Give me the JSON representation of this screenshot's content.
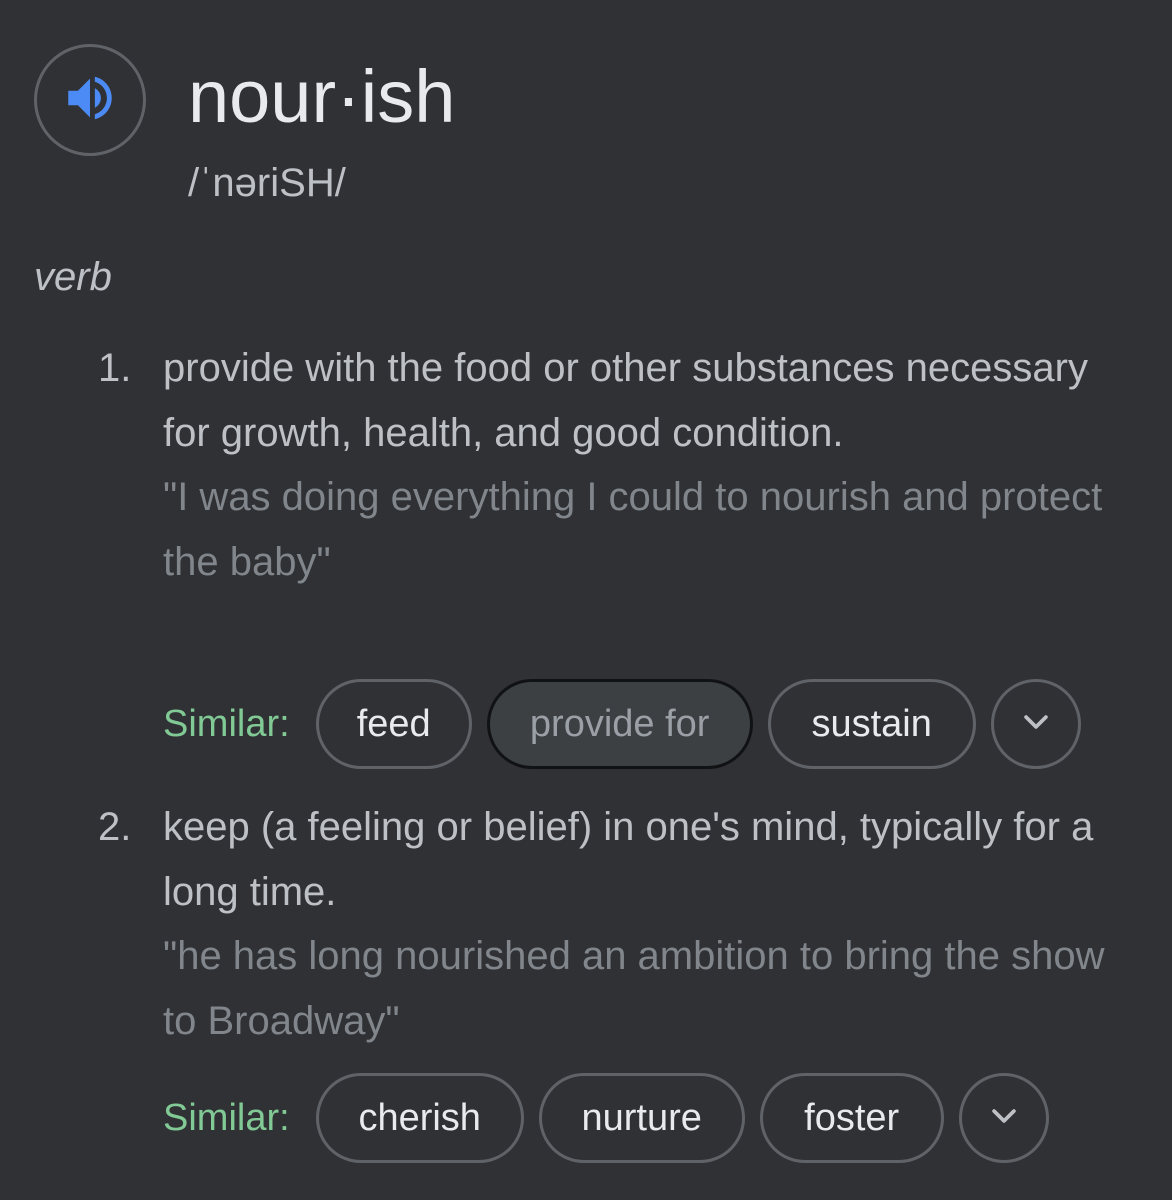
{
  "entry": {
    "headword": "nour·ish",
    "phonetic": "/ˈnəriSH/",
    "part_of_speech": "verb",
    "speaker_icon": "volume-icon",
    "accent_color": "#4c8bf5"
  },
  "senses": [
    {
      "number": "1.",
      "definition": "provide with the food or other substances necessary for growth, health, and good condition.",
      "example": "\"I was doing everything I could to nourish and protect the baby\"",
      "similar_label": "Similar:",
      "similar": [
        "feed",
        "provide for",
        "sustain"
      ],
      "focused_chip": "provide for",
      "more_icon": "chevron-down-icon"
    },
    {
      "number": "2.",
      "definition": "keep (a feeling or belief) in one's mind, typically for a long time.",
      "example": "\"he has long nourished an ambition to bring the show to Broadway\"",
      "similar_label": "Similar:",
      "similar": [
        "cherish",
        "nurture",
        "foster"
      ],
      "more_icon": "chevron-down-icon"
    }
  ],
  "colors": {
    "background": "#303134",
    "similar_label": "#81c995",
    "example_text": "#80868b"
  }
}
